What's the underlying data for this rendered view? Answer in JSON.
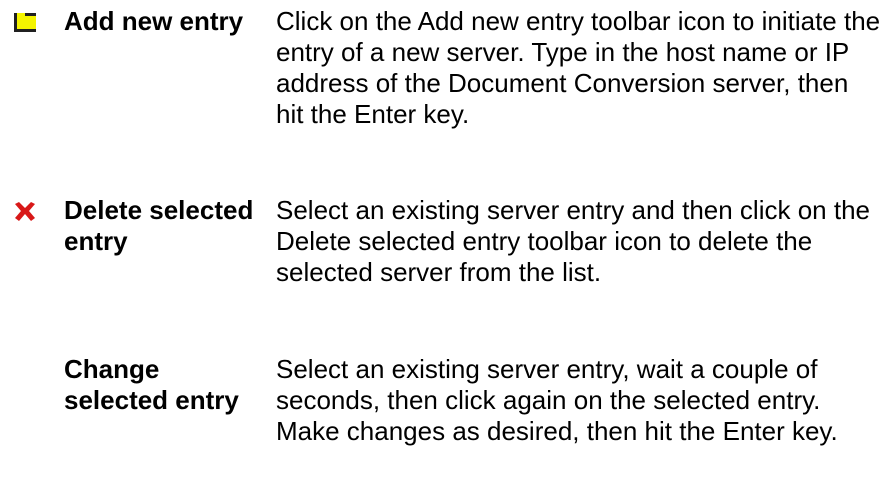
{
  "colors": {
    "add_icon_yellow": "#f4f400",
    "add_icon_dark": "#202020",
    "delete_icon_red": "#d81818",
    "text": "#000000",
    "background": "#ffffff"
  },
  "entries": [
    {
      "icon": "add-entry-icon",
      "term": "Add new entry",
      "description": "Click on the Add new entry toolbar icon to initiate the entry of a new server. Type in the host name or IP address of the Document Conversion server, then hit the Enter key."
    },
    {
      "icon": "delete-entry-icon",
      "term": "Delete selected entry",
      "description": "Select an existing server entry and then click on the Delete selected entry toolbar icon to delete the selected server from the list."
    },
    {
      "icon": "",
      "term": "Change selected entry",
      "description": "Select an existing server entry, wait a couple of seconds, then click again on the selected entry. Make changes as desired, then hit the Enter key."
    }
  ]
}
